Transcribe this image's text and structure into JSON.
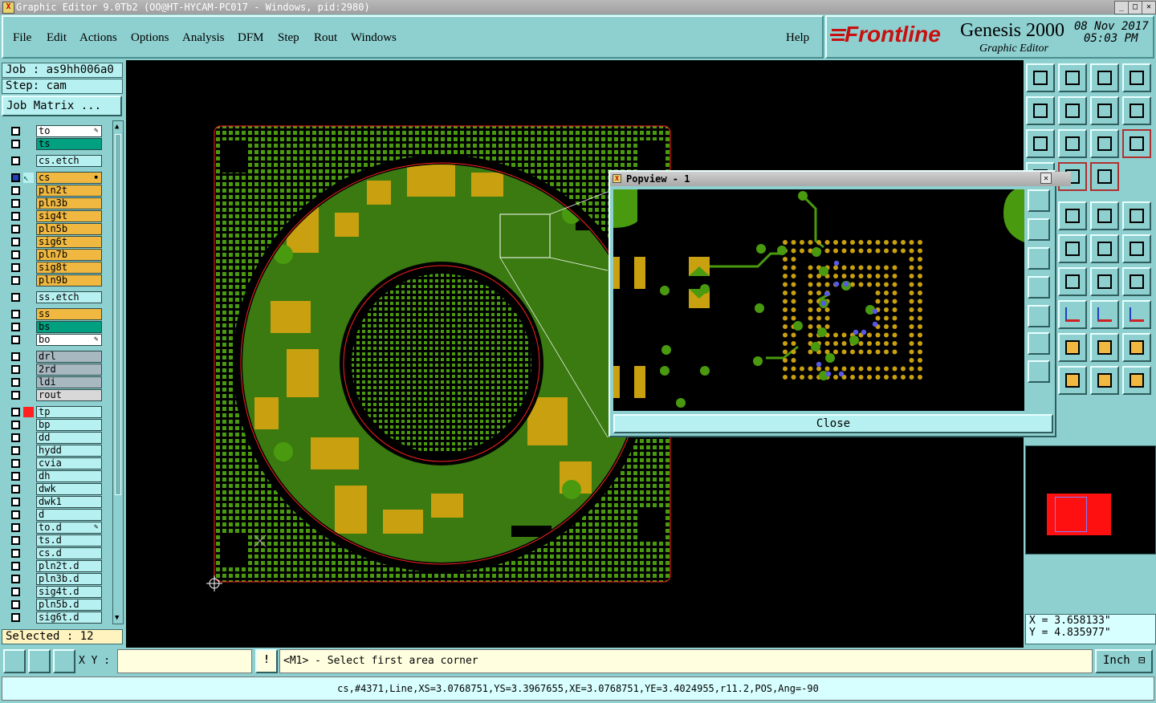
{
  "window": {
    "title": "Graphic Editor 9.0Tb2 (OO@HT-HYCAM-PC017 - Windows, pid:2980)"
  },
  "menu": {
    "items": [
      "File",
      "Edit",
      "Actions",
      "Options",
      "Analysis",
      "DFM",
      "Step",
      "Rout",
      "Windows"
    ],
    "help": "Help"
  },
  "brand": {
    "logo": "Frontline",
    "product": "Genesis 2000",
    "module": "Graphic Editor",
    "date": "08 Nov 2017",
    "time": "05:03 PM"
  },
  "job": {
    "job_label": "Job : as9hh006a0",
    "step_label": "Step: cam",
    "matrix_button": "Job Matrix ..."
  },
  "layers": [
    {
      "name": "to",
      "color": "#ffffff",
      "mark": "pencil"
    },
    {
      "name": "ts",
      "color": "#00a080"
    },
    {
      "name": "cs.etch",
      "color": "#b7f0f0",
      "gap": true
    },
    {
      "name": "cs",
      "color": "#f0b840",
      "mark": "box",
      "active": true,
      "gap": true
    },
    {
      "name": "pln2t",
      "color": "#f0b840"
    },
    {
      "name": "pln3b",
      "color": "#f0b840"
    },
    {
      "name": "sig4t",
      "color": "#f0b840"
    },
    {
      "name": "pln5b",
      "color": "#f0b840"
    },
    {
      "name": "sig6t",
      "color": "#f0b840"
    },
    {
      "name": "pln7b",
      "color": "#f0b840"
    },
    {
      "name": "sig8t",
      "color": "#f0b840"
    },
    {
      "name": "pln9b",
      "color": "#f0b840"
    },
    {
      "name": "ss.etch",
      "color": "#b7f0f0",
      "gap": true
    },
    {
      "name": "ss",
      "color": "#f0b840",
      "gap": true
    },
    {
      "name": "bs",
      "color": "#00a080"
    },
    {
      "name": "bo",
      "color": "#ffffff",
      "mark": "pencil"
    },
    {
      "name": "drl",
      "color": "#a8b8c0",
      "gap": true
    },
    {
      "name": "2rd",
      "color": "#a8b8c0"
    },
    {
      "name": "ldi",
      "color": "#a8b8c0"
    },
    {
      "name": "rout",
      "color": "#d8d8d8"
    },
    {
      "name": "tp",
      "color": "#b7f0f0",
      "gap": true,
      "ind": "#ff2020"
    },
    {
      "name": "bp",
      "color": "#b7f0f0"
    },
    {
      "name": "dd",
      "color": "#b7f0f0"
    },
    {
      "name": "hydd",
      "color": "#b7f0f0"
    },
    {
      "name": "cvia",
      "color": "#b7f0f0"
    },
    {
      "name": "dh",
      "color": "#b7f0f0"
    },
    {
      "name": "dwk",
      "color": "#b7f0f0"
    },
    {
      "name": "dwk1",
      "color": "#b7f0f0"
    },
    {
      "name": "d",
      "color": "#b7f0f0"
    },
    {
      "name": "to.d",
      "color": "#b7f0f0",
      "mark": "pencil"
    },
    {
      "name": "ts.d",
      "color": "#b7f0f0"
    },
    {
      "name": "cs.d",
      "color": "#b7f0f0"
    },
    {
      "name": "pln2t.d",
      "color": "#b7f0f0"
    },
    {
      "name": "pln3b.d",
      "color": "#b7f0f0"
    },
    {
      "name": "sig4t.d",
      "color": "#b7f0f0"
    },
    {
      "name": "pln5b.d",
      "color": "#b7f0f0"
    },
    {
      "name": "sig6t.d",
      "color": "#b7f0f0"
    }
  ],
  "selected": "Selected : 12",
  "popview": {
    "title": "Popview - 1",
    "close_label": "Close"
  },
  "coords": {
    "x": "X = 3.658133\"",
    "y": "Y = 4.835977\""
  },
  "bottom": {
    "xy_label": "X Y :",
    "xy_value": "",
    "prompt": "<M1> - Select first area corner",
    "units": "Inch"
  },
  "status": "cs,#4371,Line,XS=3.0768751,YS=3.3967655,XE=3.0768751,YE=3.4024955,r11.2,POS,Ang=-90",
  "colors": {
    "panel": "#8ecfcf",
    "pcb_green": "#4a9a10",
    "pcb_copper": "#c8a010",
    "outline": "#ff2020"
  }
}
